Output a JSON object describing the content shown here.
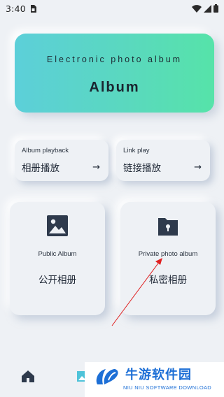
{
  "status_bar": {
    "time": "3:40"
  },
  "hero": {
    "subtitle": "Electronic photo album",
    "title": "Album"
  },
  "cards": {
    "album_playback": {
      "en": "Album playback",
      "cn": "相册播放",
      "arrow": "→"
    },
    "link_play": {
      "en": "Link play",
      "cn": "链接播放",
      "arrow": "→"
    },
    "public_album": {
      "en": "Public Album",
      "cn": "公开相册",
      "icon": "image-icon"
    },
    "private_album": {
      "en": "Private photo album",
      "cn": "私密相册",
      "icon": "locked-folder-icon"
    }
  },
  "bottom_nav": {
    "items": [
      {
        "icon": "home-icon"
      },
      {
        "icon": "album-icon"
      }
    ]
  },
  "watermark": {
    "title": "牛游软件园",
    "subtitle": "NIU NIU SOFTWARE DOWNLOAD"
  },
  "colors": {
    "background": "#eef1f5",
    "hero_gradient_start": "#5ccfd9",
    "hero_gradient_end": "#56e3a9",
    "icon_dark": "#2e3a4c",
    "annotation_red": "#e02020",
    "watermark_blue": "#1d6fd6"
  }
}
